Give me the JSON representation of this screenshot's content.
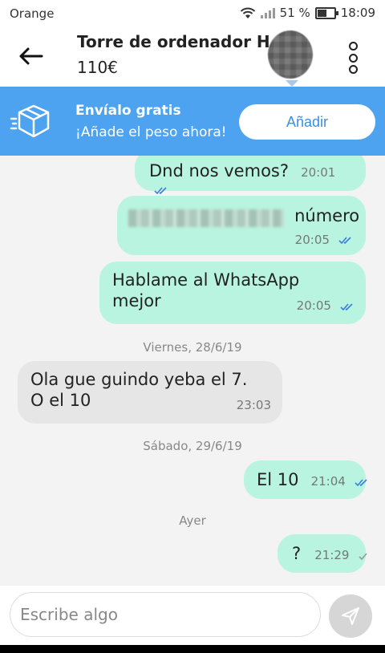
{
  "status_bar": {
    "carrier": "Orange",
    "battery": "51 %",
    "time": "18:09"
  },
  "header": {
    "title": "Torre de ordenador H...",
    "price": "110€"
  },
  "banner": {
    "title": "Envíalo gratis",
    "subtitle": "¡Añade el peso ahora!",
    "button": "Añadir"
  },
  "messages": [
    {
      "direction": "out",
      "text": "Dnd nos vemos?",
      "time": "20:01",
      "status": "read"
    },
    {
      "direction": "out",
      "text": "número",
      "time": "20:05",
      "status": "read",
      "redacted_prefix": true
    },
    {
      "direction": "out",
      "text": "Hablame al WhatsApp\nmejor",
      "time": "20:05",
      "status": "read"
    },
    {
      "direction": "in",
      "text": "Ola gue guindo yeba el 7.\nO el 10",
      "time": "23:03"
    },
    {
      "direction": "out",
      "text": "El 10",
      "time": "21:04",
      "status": "read"
    },
    {
      "direction": "out",
      "text": "?",
      "time": "21:29",
      "status": "sent"
    }
  ],
  "dividers": [
    "Viernes, 28/6/19",
    "Sábado, 29/6/19",
    "Ayer"
  ],
  "composer": {
    "placeholder": "Escribe algo"
  },
  "icons": {
    "back": "arrow-left-icon",
    "menu": "more-vertical-icon",
    "box": "package-icon",
    "send": "send-icon",
    "wifi": "wifi-icon",
    "signal": "signal-icon",
    "battery": "battery-icon"
  },
  "colors": {
    "banner": "#4da3ef",
    "outgoing_bubble": "#b8f4df",
    "incoming_bubble": "#e6e6e6",
    "read_tick": "#3b7de0",
    "sent_tick": "#999999"
  }
}
